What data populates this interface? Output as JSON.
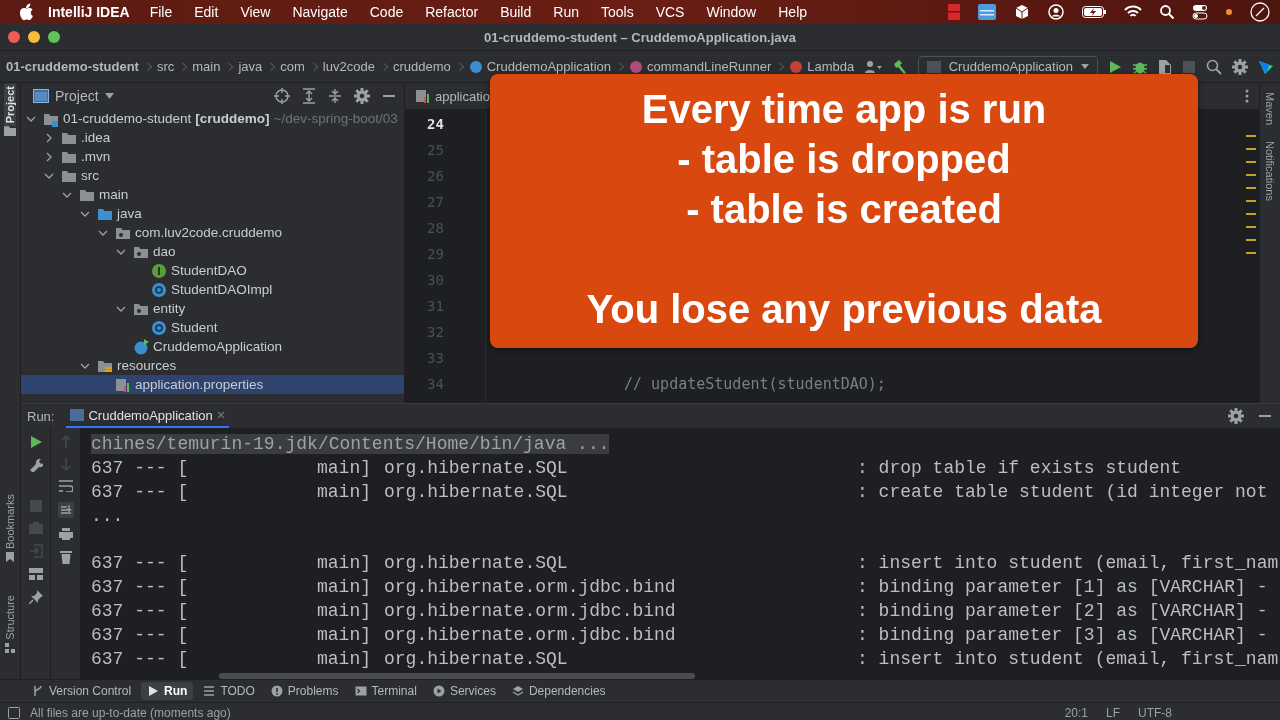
{
  "menu_bar": {
    "app_name": "IntelliJ IDEA",
    "menus": [
      "File",
      "Edit",
      "View",
      "Navigate",
      "Code",
      "Refactor",
      "Build",
      "Run",
      "Tools",
      "VCS",
      "Window",
      "Help"
    ]
  },
  "window": {
    "title": "01-cruddemo-student – CruddemoApplication.java"
  },
  "breadcrumbs": [
    {
      "label": "01-cruddemo-student",
      "kind": "project"
    },
    {
      "label": "src",
      "kind": "dir"
    },
    {
      "label": "main",
      "kind": "dir"
    },
    {
      "label": "java",
      "kind": "dir"
    },
    {
      "label": "com",
      "kind": "dir"
    },
    {
      "label": "luv2code",
      "kind": "dir"
    },
    {
      "label": "cruddemo",
      "kind": "dir"
    },
    {
      "label": "CruddemoApplication",
      "kind": "class"
    },
    {
      "label": "commandLineRunner",
      "kind": "method"
    },
    {
      "label": "Lambda",
      "kind": "lambda"
    }
  ],
  "run_config": {
    "label": "CruddemoApplication"
  },
  "left_strip": {
    "top": [
      {
        "label": "Project",
        "selected": true
      }
    ],
    "bottom": [
      "Bookmarks",
      "Structure"
    ]
  },
  "project_panel": {
    "title": "Project",
    "tree": [
      {
        "label": "01-cruddemo-student",
        "module": "[cruddemo]",
        "path": "~/dev-spring-boot/03",
        "kind": "module",
        "expanded": true,
        "selected": false,
        "children": [
          {
            "label": ".idea",
            "kind": "folder",
            "expanded": false,
            "selected": false
          },
          {
            "label": ".mvn",
            "kind": "folder",
            "expanded": false,
            "selected": false
          },
          {
            "label": "src",
            "kind": "folder",
            "expanded": true,
            "selected": false,
            "children": [
              {
                "label": "main",
                "kind": "folder",
                "expanded": true,
                "selected": false,
                "children": [
                  {
                    "label": "java",
                    "kind": "source",
                    "expanded": true,
                    "selected": false,
                    "children": [
                      {
                        "label": "com.luv2code.cruddemo",
                        "kind": "package",
                        "expanded": true,
                        "selected": false,
                        "children": [
                          {
                            "label": "dao",
                            "kind": "package",
                            "expanded": true,
                            "selected": false,
                            "children": [
                              {
                                "label": "StudentDAO",
                                "kind": "interface",
                                "selected": false
                              },
                              {
                                "label": "StudentDAOImpl",
                                "kind": "class",
                                "selected": false
                              }
                            ]
                          },
                          {
                            "label": "entity",
                            "kind": "package",
                            "expanded": true,
                            "selected": false,
                            "children": [
                              {
                                "label": "Student",
                                "kind": "class",
                                "selected": false
                              }
                            ]
                          },
                          {
                            "label": "CruddemoApplication",
                            "kind": "app",
                            "selected": false
                          }
                        ]
                      }
                    ]
                  },
                  {
                    "label": "resources",
                    "kind": "resources",
                    "expanded": true,
                    "selected": false,
                    "children": [
                      {
                        "label": "application.properties",
                        "kind": "properties",
                        "selected": true
                      }
                    ]
                  }
                ]
              }
            ]
          }
        ]
      }
    ]
  },
  "editor": {
    "tab": "applicatio",
    "lines": [
      {
        "number": "24",
        "current": true
      },
      {
        "number": "25",
        "current": false
      },
      {
        "number": "26",
        "current": false
      },
      {
        "number": "27",
        "current": false
      },
      {
        "number": "28",
        "current": false
      },
      {
        "number": "29",
        "current": false
      },
      {
        "number": "30",
        "current": false
      },
      {
        "number": "31",
        "current": false
      },
      {
        "number": "32",
        "current": false
      },
      {
        "number": "33",
        "current": false
      },
      {
        "number": "34",
        "current": false,
        "code": "// updateStudent(studentDAO);"
      }
    ]
  },
  "right_strip": [
    "Maven",
    "Notifications"
  ],
  "callout": {
    "lines": [
      "Every time app is run",
      "- table is dropped",
      "- table is created"
    ],
    "footer": "You lose any previous data"
  },
  "run_panel": {
    "label": "Run:",
    "tabs": [
      {
        "label": "CruddemoApplication",
        "selected": true
      }
    ],
    "console": [
      {
        "kind": "command",
        "text": "chines/temurin-19.jdk/Contents/Home/bin/java ..."
      },
      {
        "kind": "log",
        "pid": "637 --- [",
        "thread": "main]",
        "logger": "org.hibernate.SQL",
        "message": ": drop table if exists student"
      },
      {
        "kind": "log",
        "pid": "637 --- [",
        "thread": "main]",
        "logger": "org.hibernate.SQL",
        "message": ": create table student (id integer not"
      },
      {
        "kind": "plain",
        "text": "..."
      },
      {
        "kind": "blank"
      },
      {
        "kind": "log",
        "pid": "637 --- [",
        "thread": "main]",
        "logger": "org.hibernate.SQL",
        "message": ": insert into student (email, first_nam"
      },
      {
        "kind": "log",
        "pid": "637 --- [",
        "thread": "main]",
        "logger": "org.hibernate.orm.jdbc.bind",
        "message": ": binding parameter [1] as [VARCHAR] -"
      },
      {
        "kind": "log",
        "pid": "637 --- [",
        "thread": "main]",
        "logger": "org.hibernate.orm.jdbc.bind",
        "message": ": binding parameter [2] as [VARCHAR] -"
      },
      {
        "kind": "log",
        "pid": "637 --- [",
        "thread": "main]",
        "logger": "org.hibernate.orm.jdbc.bind",
        "message": ": binding parameter [3] as [VARCHAR] -"
      },
      {
        "kind": "log",
        "pid": "637 --- [",
        "thread": "main]",
        "logger": "org.hibernate.SQL",
        "message": ": insert into student (email, first_nam"
      }
    ]
  },
  "tool_tabs": [
    {
      "label": "Version Control",
      "kind": "vcs",
      "selected": false
    },
    {
      "label": "Run",
      "kind": "run",
      "selected": true
    },
    {
      "label": "TODO",
      "kind": "todo",
      "selected": false
    },
    {
      "label": "Problems",
      "kind": "problems",
      "selected": false
    },
    {
      "label": "Terminal",
      "kind": "terminal",
      "selected": false
    },
    {
      "label": "Services",
      "kind": "services",
      "selected": false
    },
    {
      "label": "Dependencies",
      "kind": "dependencies",
      "selected": false
    }
  ],
  "status_bar": {
    "message": "All files are up-to-date (moments ago)",
    "items": [
      "20:1",
      "LF",
      "UTF-8"
    ]
  }
}
